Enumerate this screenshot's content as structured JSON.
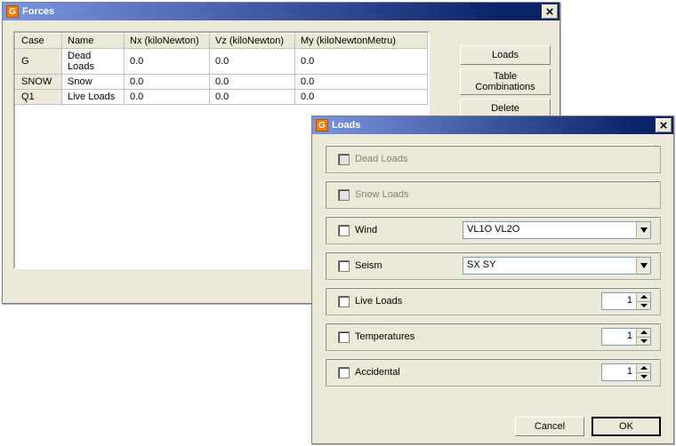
{
  "forces": {
    "title": "Forces",
    "icon_letter": "G",
    "columns": {
      "case": "Case",
      "name": "Name",
      "nx": "Nx (kiloNewton)",
      "vz": "Vz (kiloNewton)",
      "my": "My (kiloNewtonMetru)"
    },
    "rows": [
      {
        "case": "G",
        "name": "Dead Loads",
        "nx": "0.0",
        "vz": "0.0",
        "my": "0.0"
      },
      {
        "case": "SNOW",
        "name": "Snow",
        "nx": "0.0",
        "vz": "0.0",
        "my": "0.0"
      },
      {
        "case": "Q1",
        "name": "Live Loads",
        "nx": "0.0",
        "vz": "0.0",
        "my": "0.0"
      }
    ],
    "buttons": {
      "loads": "Loads",
      "table_comb": "Table\nCombinations",
      "delete": "Delete"
    }
  },
  "loads": {
    "title": "Loads",
    "icon_letter": "G",
    "options": {
      "dead": {
        "label": "Dead Loads"
      },
      "snow": {
        "label": "Snow Loads"
      },
      "wind": {
        "label": "Wind",
        "value": "VL1O VL2O"
      },
      "seism": {
        "label": "Seism",
        "value": "SX SY"
      },
      "live": {
        "label": "Live Loads",
        "value": "1"
      },
      "temp": {
        "label": "Temperatures",
        "value": "1"
      },
      "acc": {
        "label": "Accidental",
        "value": "1"
      }
    },
    "buttons": {
      "cancel": "Cancel",
      "ok": "OK"
    }
  }
}
